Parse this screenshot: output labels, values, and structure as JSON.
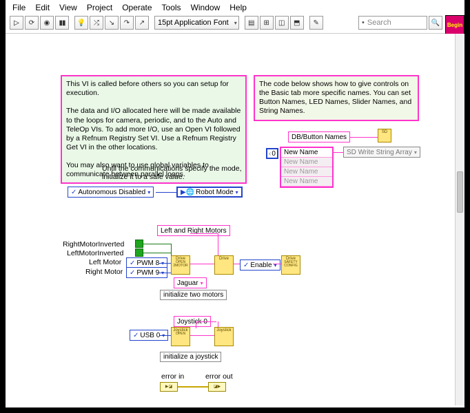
{
  "menu": [
    "File",
    "Edit",
    "View",
    "Project",
    "Operate",
    "Tools",
    "Window",
    "Help"
  ],
  "toolbar": {
    "font": "15pt Application Font",
    "search_placeholder": "Search",
    "help": "?"
  },
  "begin_badge": "Begin",
  "comments": {
    "main": "This VI is called before others so you can setup for execution.\n\nThe data and I/O allocated here will be made available to the loops for camera, periodic, and to the Auto and TeleOp VIs. To add more I/O, use an Open VI followed by a Refnum Registry Set VI.  Use a Refnum Registry Get VI in the other locations.\n\nYou may also want to use global variables to communicate between parallel loops.",
    "right": "The code below shows how to give controls on the Basic tab more specific names. You can set Button Names, LED Names, Slider Names, and String Names.",
    "mode_note": "Until the communications specify the mode, initialize it to a safe value."
  },
  "nodes": {
    "autonomous_disabled": "Autonomous Disabled",
    "robot_mode": "Robot Mode",
    "left_right_motors": "Left and Right Motors",
    "right_inverted_label": "RightMotorInverted",
    "left_inverted_label": "LeftMotorInverted",
    "left_motor_label": "Left Motor",
    "right_motor_label": "Right Motor",
    "pwm8": "PWM 8",
    "pwm9": "PWM 9",
    "jaguar": "Jaguar",
    "enable": "Enable",
    "init_two_motors": "initialize two motors",
    "joystick0": "Joystick 0",
    "usb0": "USB 0",
    "init_joystick": "initialize a joystick",
    "error_in": "error in",
    "error_out": "error out",
    "db_button_names": "DB/Button Names",
    "sd_write": "SD Write String Array",
    "array_index": "0",
    "array_rows": [
      "New Name",
      "New Name",
      "New Name",
      "New Name"
    ]
  },
  "vi_icons": {
    "drive_open": "Drive\nOPEN\n2 MOTOR",
    "drive": "Drive",
    "drive_safety": "Drive\nSAFETY\nCONFIG",
    "joystick_open": "Joystick\nOPEN",
    "joystick": "Joystick"
  }
}
